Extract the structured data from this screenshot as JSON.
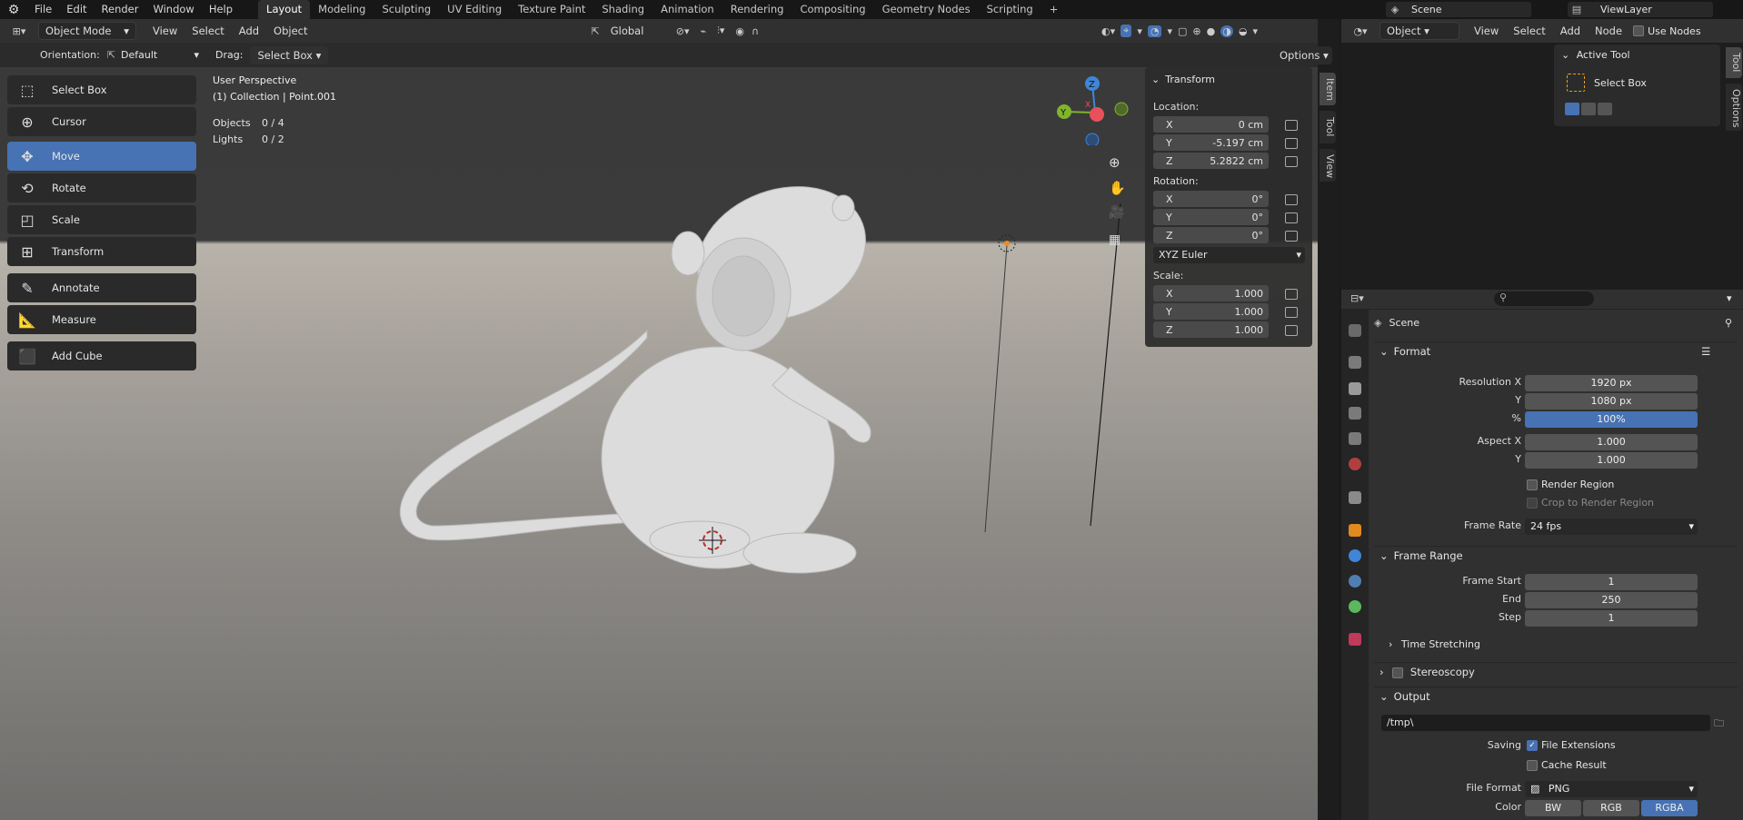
{
  "topbar": {
    "menus": [
      "File",
      "Edit",
      "Render",
      "Window",
      "Help"
    ],
    "tabs": [
      "Layout",
      "Modeling",
      "Sculpting",
      "UV Editing",
      "Texture Paint",
      "Shading",
      "Animation",
      "Rendering",
      "Compositing",
      "Geometry Nodes",
      "Scripting"
    ],
    "add_tab": "+",
    "scene": "Scene",
    "view_layer": "ViewLayer"
  },
  "viewport_header": {
    "mode": "Object Mode",
    "menus": [
      "View",
      "Select",
      "Add",
      "Object"
    ],
    "transform_orientation": "Global"
  },
  "tool_settings": {
    "orientation_label": "Orientation:",
    "orientation_value": "Default",
    "drag_label": "Drag:",
    "drag_value": "Select Box",
    "options": "Options"
  },
  "overlay": {
    "perspective": "User Perspective",
    "collection": "(1) Collection | Point.001",
    "objects_label": "Objects",
    "objects_value": "0 / 4",
    "lights_label": "Lights",
    "lights_value": "0 / 2"
  },
  "toolbar": [
    "Select Box",
    "Cursor",
    "Move",
    "Rotate",
    "Scale",
    "Transform",
    "Annotate",
    "Measure",
    "Add Cube"
  ],
  "transform_panel": {
    "title": "Transform",
    "location_label": "Location:",
    "location": [
      {
        "axis": "X",
        "value": "0 cm"
      },
      {
        "axis": "Y",
        "value": "-5.197 cm"
      },
      {
        "axis": "Z",
        "value": "5.2822 cm"
      }
    ],
    "rotation_label": "Rotation:",
    "rotation": [
      {
        "axis": "X",
        "value": "0°"
      },
      {
        "axis": "Y",
        "value": "0°"
      },
      {
        "axis": "Z",
        "value": "0°"
      }
    ],
    "rotation_mode": "XYZ Euler",
    "scale_label": "Scale:",
    "scale": [
      {
        "axis": "X",
        "value": "1.000"
      },
      {
        "axis": "Y",
        "value": "1.000"
      },
      {
        "axis": "Z",
        "value": "1.000"
      }
    ]
  },
  "side_tabs": [
    "Item",
    "Tool",
    "View"
  ],
  "node_editor": {
    "object": "Object",
    "menus": [
      "View",
      "Select",
      "Add",
      "Node"
    ],
    "use_nodes": "Use Nodes",
    "active_tool": "Active Tool",
    "select_box": "Select Box",
    "side_tabs": [
      "Tool",
      "Options"
    ]
  },
  "properties": {
    "scene": "Scene",
    "format_title": "Format",
    "res_x_label": "Resolution X",
    "res_x": "1920 px",
    "res_y_label": "Y",
    "res_y": "1080 px",
    "pct_label": "%",
    "pct": "100%",
    "aspect_x_label": "Aspect X",
    "aspect_x": "1.000",
    "aspect_y_label": "Y",
    "aspect_y": "1.000",
    "render_region": "Render Region",
    "crop_region": "Crop to Render Region",
    "frame_rate_label": "Frame Rate",
    "frame_rate": "24 fps",
    "frame_range_title": "Frame Range",
    "frame_start_label": "Frame Start",
    "frame_start": "1",
    "end_label": "End",
    "end": "250",
    "step_label": "Step",
    "step": "1",
    "time_stretching": "Time Stretching",
    "stereoscopy": "Stereoscopy",
    "output_title": "Output",
    "output_path": "/tmp\\",
    "saving_label": "Saving",
    "file_ext": "File Extensions",
    "cache_result": "Cache Result",
    "file_format_label": "File Format",
    "file_format": "PNG",
    "color_label": "Color",
    "color_opts": [
      "BW",
      "RGB",
      "RGBA"
    ]
  },
  "gizmo": {
    "z": "Z",
    "y": "Y",
    "x": "X"
  },
  "colors": {
    "accent": "#4772b3",
    "gizmo_x": "#e8505d",
    "gizmo_y": "#7fb52a",
    "gizmo_z": "#3f86d6"
  }
}
